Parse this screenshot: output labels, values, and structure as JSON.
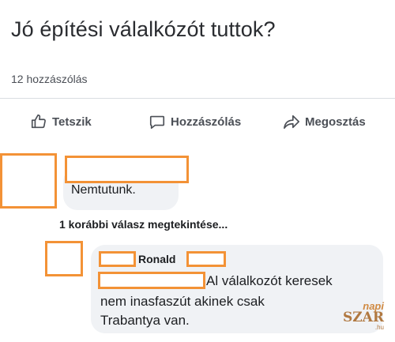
{
  "post": {
    "title": "Jó építési válalkózót tuttok?",
    "comments_count": "12 hozzászólás"
  },
  "actions": {
    "like_label": "Tetszik",
    "comment_label": "Hozzászólás",
    "share_label": "Megosztás"
  },
  "comments": [
    {
      "text": "Nemtutunk."
    }
  ],
  "more_replies_label": "1 korábbi válasz megtekintése...",
  "reply": {
    "author_fragment": "Ronald",
    "lines": [
      "Al válalkozót keresek",
      "nem inasfaszút akinek csak",
      "Trabantya van."
    ]
  },
  "watermark": {
    "top": "napi",
    "bottom": "SZAR",
    "sub": ".hu"
  },
  "colors": {
    "redaction_border": "#f39236",
    "bubble_bg": "#f0f2f5"
  }
}
